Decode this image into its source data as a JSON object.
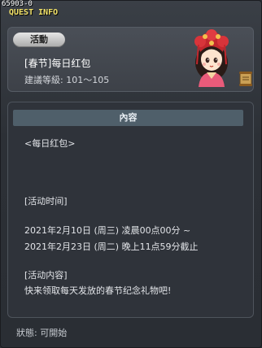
{
  "window": {
    "quest_id": "65903-0",
    "title": "QUEST INFO"
  },
  "header": {
    "badge": "活動",
    "quest_name": "[春节]每日红包",
    "level_requirement": "建議等級: 101～105",
    "npc_icon": "npc-portrait-icon",
    "scroll_icon": "scroll-icon"
  },
  "content": {
    "tab_label": "內容",
    "lines": [
      "<每日红包>",
      "[活动时间]",
      "2021年2月10日 (周三) 凌晨00点00分 ~",
      "2021年2月23日 (周二) 晚上11点59分截止",
      "[活动内容]",
      "快来领取每天发放的春节纪念礼物吧!"
    ]
  },
  "footer": {
    "status": "狀態: 可開始"
  }
}
